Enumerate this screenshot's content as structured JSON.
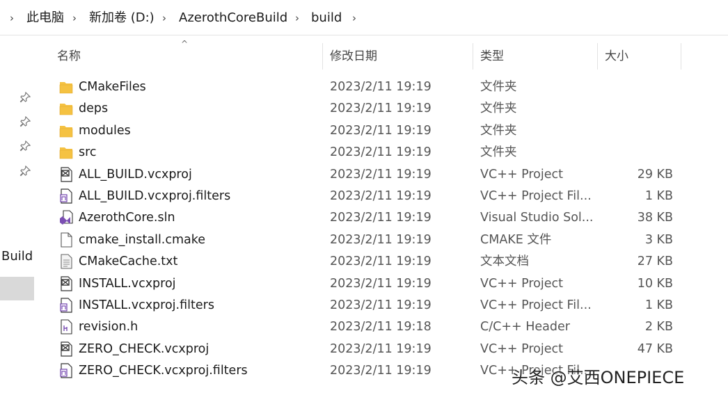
{
  "breadcrumb": {
    "items": [
      "此电脑",
      "新加卷 (D:)",
      "AzerothCoreBuild",
      "build"
    ],
    "separator": "›"
  },
  "nav": {
    "quick_access_item_label": "Build",
    "pins": [
      "pin-icon",
      "pin-icon",
      "pin-icon",
      "pin-icon"
    ]
  },
  "columns": {
    "name": "名称",
    "date": "修改日期",
    "type": "类型",
    "size": "大小",
    "sort_arrow": "^"
  },
  "files": [
    {
      "name": "CMakeFiles",
      "date": "2023/2/11 19:19",
      "type": "文件夹",
      "size": "",
      "icon": "folder-icon"
    },
    {
      "name": "deps",
      "date": "2023/2/11 19:19",
      "type": "文件夹",
      "size": "",
      "icon": "folder-icon"
    },
    {
      "name": "modules",
      "date": "2023/2/11 19:19",
      "type": "文件夹",
      "size": "",
      "icon": "folder-icon"
    },
    {
      "name": "src",
      "date": "2023/2/11 19:19",
      "type": "文件夹",
      "size": "",
      "icon": "folder-icon"
    },
    {
      "name": "ALL_BUILD.vcxproj",
      "date": "2023/2/11 19:19",
      "type": "VC++ Project",
      "size": "29 KB",
      "icon": "vcxproj-icon"
    },
    {
      "name": "ALL_BUILD.vcxproj.filters",
      "date": "2023/2/11 19:19",
      "type": "VC++ Project Fil...",
      "size": "1 KB",
      "icon": "filters-icon"
    },
    {
      "name": "AzerothCore.sln",
      "date": "2023/2/11 19:19",
      "type": "Visual Studio Sol...",
      "size": "38 KB",
      "icon": "sln-icon"
    },
    {
      "name": "cmake_install.cmake",
      "date": "2023/2/11 19:19",
      "type": "CMAKE 文件",
      "size": "3 KB",
      "icon": "blank-file-icon"
    },
    {
      "name": "CMakeCache.txt",
      "date": "2023/2/11 19:19",
      "type": "文本文档",
      "size": "27 KB",
      "icon": "text-file-icon"
    },
    {
      "name": "INSTALL.vcxproj",
      "date": "2023/2/11 19:19",
      "type": "VC++ Project",
      "size": "10 KB",
      "icon": "vcxproj-icon"
    },
    {
      "name": "INSTALL.vcxproj.filters",
      "date": "2023/2/11 19:19",
      "type": "VC++ Project Fil...",
      "size": "1 KB",
      "icon": "filters-icon"
    },
    {
      "name": "revision.h",
      "date": "2023/2/11 19:18",
      "type": "C/C++ Header",
      "size": "2 KB",
      "icon": "header-file-icon"
    },
    {
      "name": "ZERO_CHECK.vcxproj",
      "date": "2023/2/11 19:19",
      "type": "VC++ Project",
      "size": "47 KB",
      "icon": "vcxproj-icon"
    },
    {
      "name": "ZERO_CHECK.vcxproj.filters",
      "date": "2023/2/11 19:19",
      "type": "VC++ Project Fil...",
      "size": "",
      "icon": "filters-icon"
    }
  ],
  "watermark": "头条 @艾西ONEPIECE",
  "colors": {
    "folder": "#f5c242",
    "folder_dark": "#e0a82e",
    "nav_selected": "#d9d9d9",
    "sln_purple": "#7b4fb3"
  }
}
